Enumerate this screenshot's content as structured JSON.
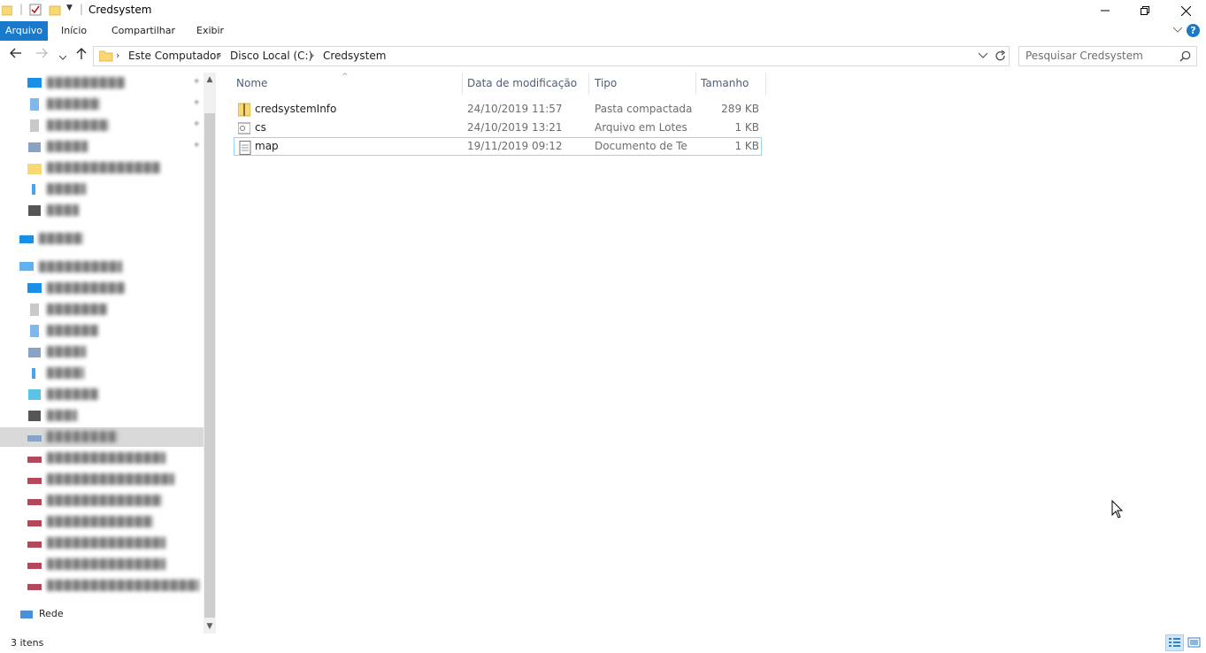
{
  "window": {
    "title": "Credsystem",
    "minimize_icon": "minimize-icon",
    "maximize_icon": "restore-icon",
    "close_icon": "close-icon"
  },
  "ribbon": {
    "tabs": [
      {
        "label": "Arquivo"
      },
      {
        "label": "Início"
      },
      {
        "label": "Compartilhar"
      },
      {
        "label": "Exibir"
      }
    ],
    "accent": "#1979ca",
    "help_label": "?"
  },
  "address": {
    "crumbs": [
      {
        "label": "Este Computador"
      },
      {
        "label": "Disco Local (C:)"
      },
      {
        "label": "Credsystem"
      }
    ],
    "search_placeholder": "Pesquisar Credsystem"
  },
  "nav": {
    "network_label": "Rede"
  },
  "columns": {
    "name": "Nome",
    "date": "Data de modificação",
    "type": "Tipo",
    "size": "Tamanho"
  },
  "files": [
    {
      "name": "credsystemInfo",
      "date": "24/10/2019 11:57",
      "type": "Pasta compactada",
      "size": "289 KB",
      "icon": "zip-folder-icon"
    },
    {
      "name": "cs",
      "date": "24/10/2019 13:21",
      "type": "Arquivo em Lotes ...",
      "size": "1 KB",
      "icon": "batch-file-icon"
    },
    {
      "name": "map",
      "date": "19/11/2019 09:12",
      "type": "Documento de Te...",
      "size": "1 KB",
      "icon": "text-file-icon"
    }
  ],
  "status": {
    "item_count": "3 itens"
  }
}
